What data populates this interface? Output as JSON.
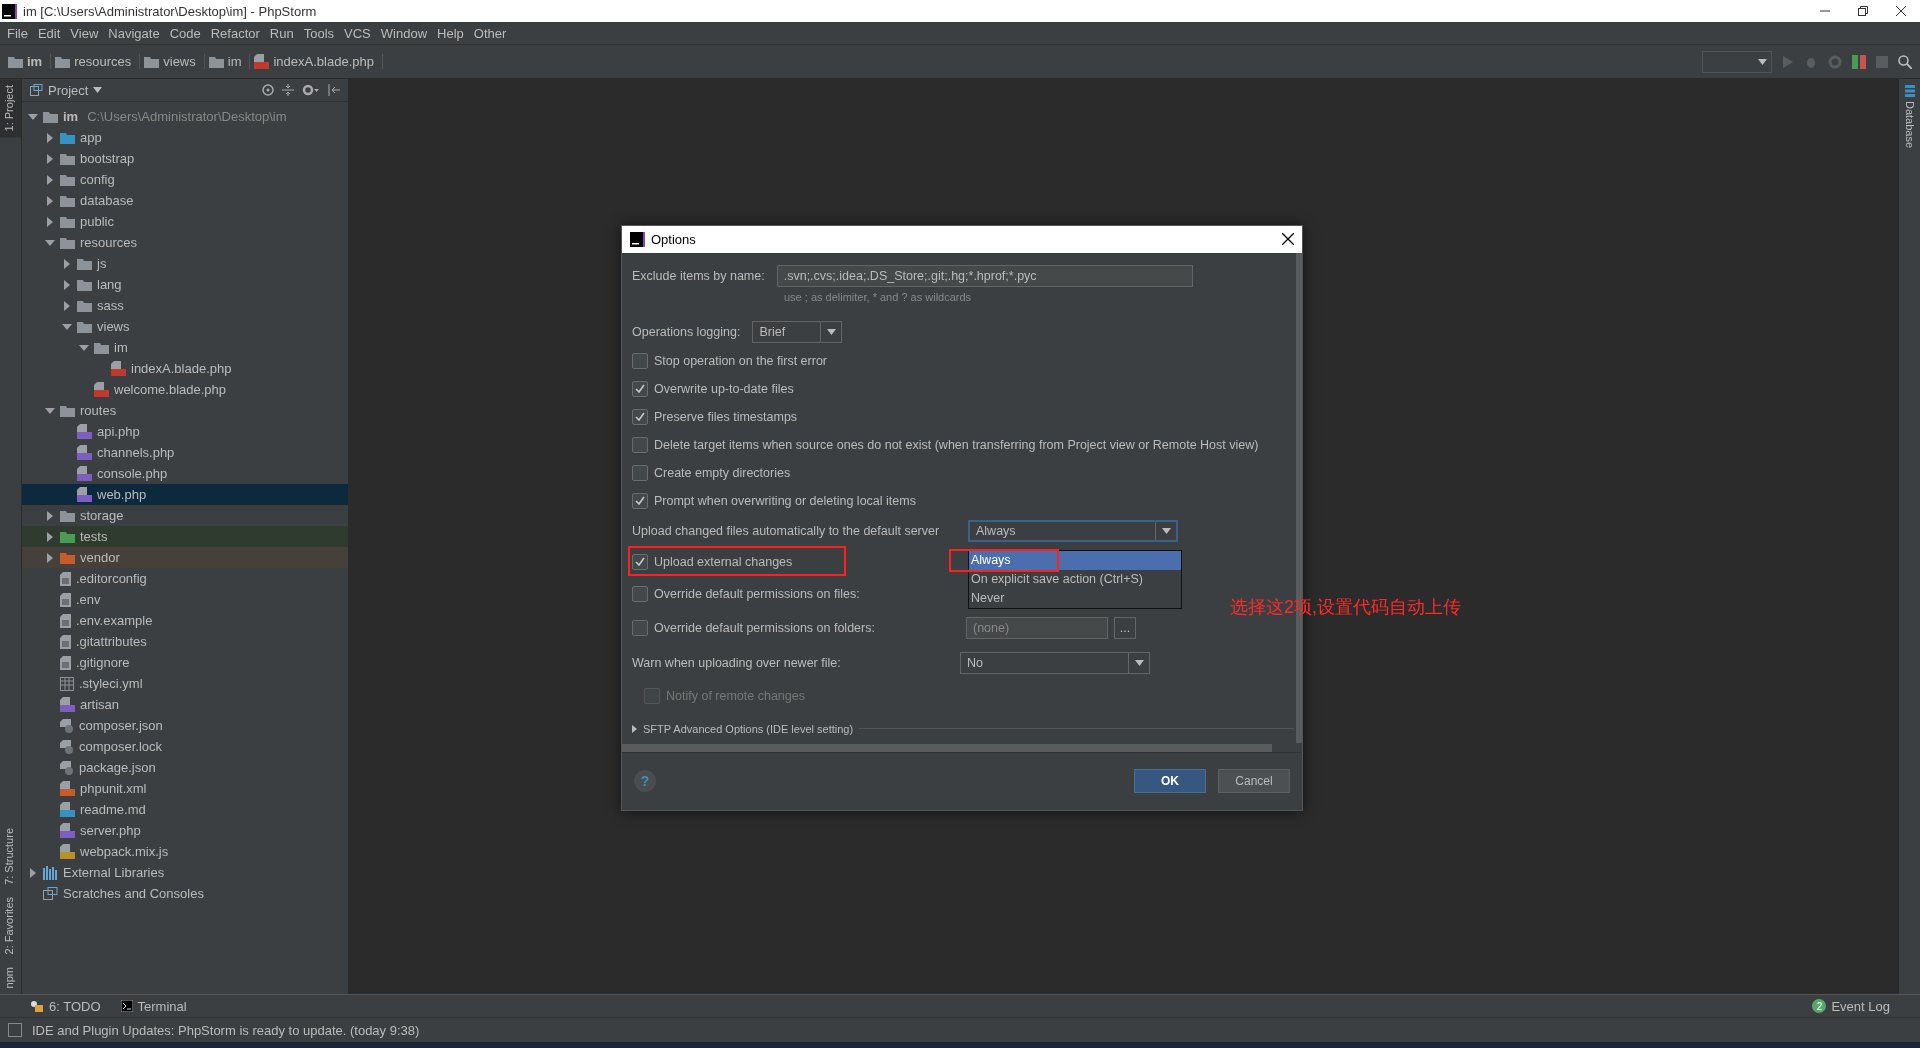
{
  "window": {
    "title": "im [C:\\Users\\Administrator\\Desktop\\im] - PhpStorm"
  },
  "menu": [
    "File",
    "Edit",
    "View",
    "Navigate",
    "Code",
    "Refactor",
    "Run",
    "Tools",
    "VCS",
    "Window",
    "Help",
    "Other"
  ],
  "breadcrumbs": [
    {
      "label": "im",
      "kind": "folder"
    },
    {
      "label": "resources",
      "kind": "folder"
    },
    {
      "label": "views",
      "kind": "folder"
    },
    {
      "label": "im",
      "kind": "folder"
    },
    {
      "label": "indexA.blade.php",
      "kind": "blade-file"
    }
  ],
  "left_tabs": [
    {
      "label": "1: Project",
      "selected": true
    },
    {
      "label": "7: Structure",
      "selected": false
    },
    {
      "label": "2: Favorites",
      "selected": false
    },
    {
      "label": "npm",
      "selected": false
    }
  ],
  "right_tabs": [
    {
      "label": "Database"
    }
  ],
  "project": {
    "title": "Project",
    "tree": [
      {
        "label": "im",
        "path": "C:\\Users\\Administrator\\Desktop\\im",
        "kind": "folder",
        "expanded": true,
        "selected": false,
        "children": [
          {
            "label": "app",
            "kind": "source-folder",
            "expanded": false,
            "selected": false
          },
          {
            "label": "bootstrap",
            "kind": "folder",
            "expanded": false,
            "selected": false
          },
          {
            "label": "config",
            "kind": "folder",
            "expanded": false,
            "selected": false
          },
          {
            "label": "database",
            "kind": "folder",
            "expanded": false,
            "selected": false
          },
          {
            "label": "public",
            "kind": "folder",
            "expanded": false,
            "selected": false
          },
          {
            "label": "resources",
            "kind": "folder",
            "expanded": true,
            "selected": false,
            "children": [
              {
                "label": "js",
                "kind": "folder",
                "expanded": false,
                "selected": false
              },
              {
                "label": "lang",
                "kind": "folder",
                "expanded": false,
                "selected": false
              },
              {
                "label": "sass",
                "kind": "folder",
                "expanded": false,
                "selected": false
              },
              {
                "label": "views",
                "kind": "folder",
                "expanded": true,
                "selected": false,
                "children": [
                  {
                    "label": "im",
                    "kind": "folder",
                    "expanded": true,
                    "selected": false,
                    "children": [
                      {
                        "label": "indexA.blade.php",
                        "kind": "blade-file",
                        "selected": false
                      }
                    ]
                  },
                  {
                    "label": "welcome.blade.php",
                    "kind": "blade-file",
                    "selected": false
                  }
                ]
              }
            ]
          },
          {
            "label": "routes",
            "kind": "folder",
            "expanded": true,
            "selected": false,
            "children": [
              {
                "label": "api.php",
                "kind": "php-file",
                "selected": false
              },
              {
                "label": "channels.php",
                "kind": "php-file",
                "selected": false
              },
              {
                "label": "console.php",
                "kind": "php-file",
                "selected": false
              },
              {
                "label": "web.php",
                "kind": "php-file",
                "selected": true
              }
            ]
          },
          {
            "label": "storage",
            "kind": "folder",
            "expanded": false,
            "selected": false
          },
          {
            "label": "tests",
            "kind": "test-folder",
            "expanded": false,
            "selected": false
          },
          {
            "label": "vendor",
            "kind": "excluded-folder",
            "expanded": false,
            "selected": false
          },
          {
            "label": ".editorconfig",
            "kind": "text-file",
            "selected": false
          },
          {
            "label": ".env",
            "kind": "text-file",
            "selected": false
          },
          {
            "label": ".env.example",
            "kind": "text-file",
            "selected": false
          },
          {
            "label": ".gitattributes",
            "kind": "text-file",
            "selected": false
          },
          {
            "label": ".gitignore",
            "kind": "text-file",
            "selected": false
          },
          {
            "label": ".styleci.yml",
            "kind": "table-file",
            "selected": false
          },
          {
            "label": "artisan",
            "kind": "php-file",
            "selected": false
          },
          {
            "label": "composer.json",
            "kind": "json-file",
            "selected": false
          },
          {
            "label": "composer.lock",
            "kind": "json-file",
            "selected": false
          },
          {
            "label": "package.json",
            "kind": "json-file",
            "selected": false
          },
          {
            "label": "phpunit.xml",
            "kind": "xml-file",
            "selected": false
          },
          {
            "label": "readme.md",
            "kind": "md-file",
            "selected": false
          },
          {
            "label": "server.php",
            "kind": "php-file",
            "selected": false
          },
          {
            "label": "webpack.mix.js",
            "kind": "js-file",
            "selected": false
          }
        ]
      },
      {
        "label": "External Libraries",
        "kind": "libraries",
        "expanded": false,
        "selected": false
      },
      {
        "label": "Scratches and Consoles",
        "kind": "scratches",
        "selected": false
      }
    ]
  },
  "dialog": {
    "title": "Options",
    "exclude": {
      "label": "Exclude items by name:",
      "value": ".svn;.cvs;.idea;.DS_Store;.git;.hg;*.hprof;*.pyc",
      "hint": "use ; as delimiter, * and ? as wildcards"
    },
    "logging": {
      "label": "Operations logging:",
      "value": "Brief"
    },
    "checkboxes": [
      {
        "label": "Stop operation on the first error",
        "checked": false
      },
      {
        "label": "Overwrite up-to-date files",
        "checked": true
      },
      {
        "label": "Preserve files timestamps",
        "checked": true
      },
      {
        "label": "Delete target items when source ones do not exist (when transferring from Project view or Remote Host view)",
        "checked": false
      },
      {
        "label": "Create empty directories",
        "checked": false
      },
      {
        "label": "Prompt when overwriting or deleting local items",
        "checked": true
      }
    ],
    "upload": {
      "label": "Upload changed files automatically to the default server",
      "value": "Always",
      "options": [
        {
          "label": "Always",
          "selected": true,
          "highlighted": true
        },
        {
          "label": "On explicit save action (Ctrl+S)",
          "selected": false,
          "highlighted": false
        },
        {
          "label": "Never",
          "selected": false,
          "highlighted": false
        }
      ]
    },
    "upload_external": {
      "label": "Upload external changes",
      "checked": true,
      "highlighted": true
    },
    "override_files": {
      "label": "Override default permissions on files:",
      "checked": false
    },
    "override_folders": {
      "label": "Override default permissions on folders:",
      "checked": false,
      "value": "(none)",
      "field_disabled": true,
      "button": "..."
    },
    "warn": {
      "label": "Warn when uploading over newer file:",
      "value": "No"
    },
    "notify": {
      "label": "Notify of remote changes",
      "checked": false,
      "disabled": true
    },
    "section": "SFTP Advanced Options (IDE level setting)",
    "help": "?",
    "ok": "OK",
    "cancel": "Cancel"
  },
  "annotation": {
    "text": "选择这2项,设置代码自动上传",
    "color": "#ff2a2a"
  },
  "bottom_tools": [
    {
      "label": "6: TODO",
      "kind": "todo"
    },
    {
      "label": "Terminal",
      "kind": "terminal"
    }
  ],
  "event_log": {
    "label": "Event Log",
    "count": "2"
  },
  "status": "IDE and Plugin Updates: PhpStorm is ready to update. (today 9:38)"
}
